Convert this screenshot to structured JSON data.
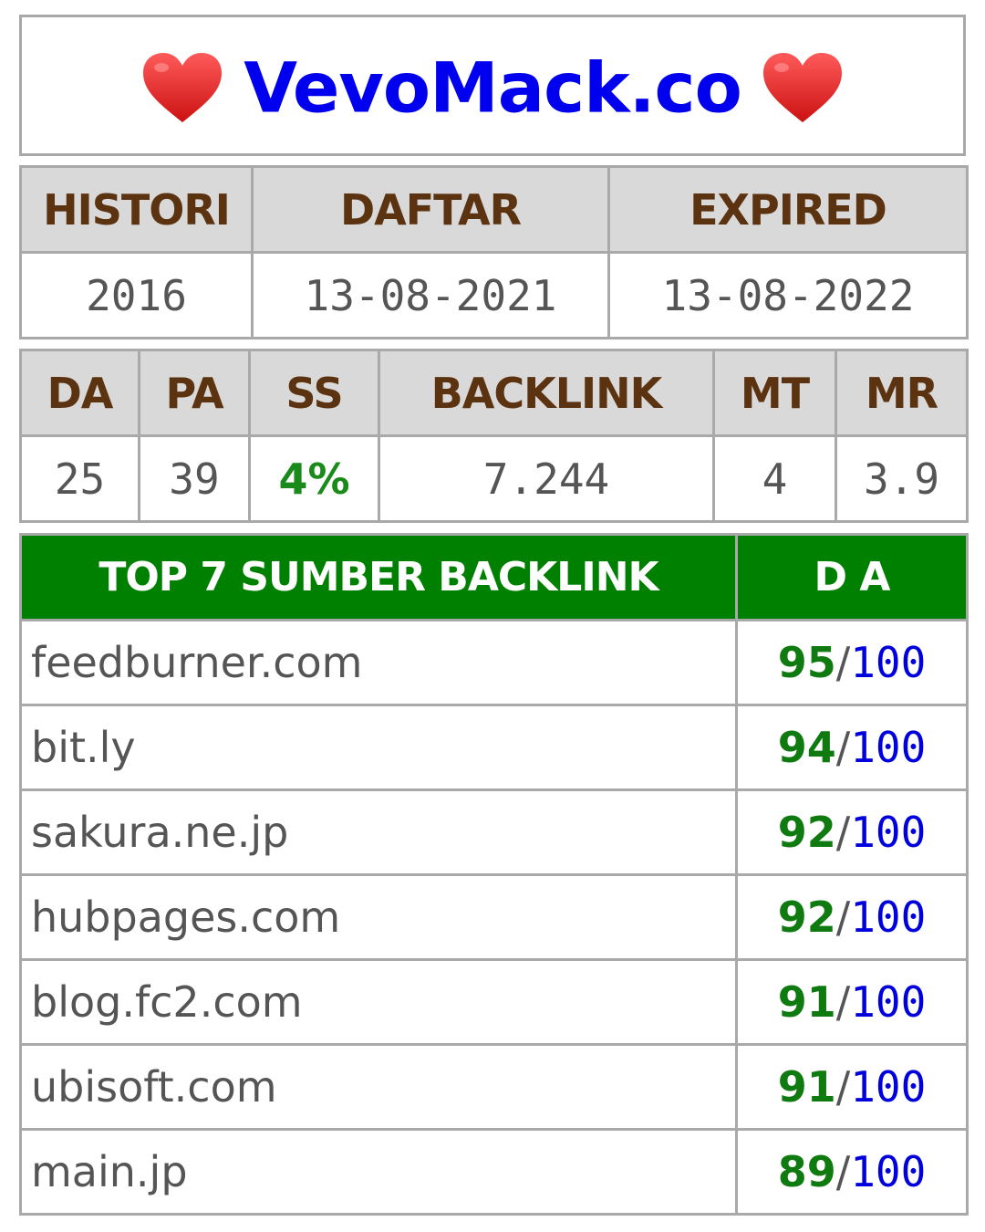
{
  "title": {
    "text": "VevoMack.co",
    "left_icon": "heart-icon",
    "right_icon": "heart-icon",
    "heart_color": "#e02424"
  },
  "history": {
    "headers": [
      "HISTORI",
      "DAFTAR",
      "EXPIRED"
    ],
    "values": [
      "2016",
      "13-08-2021",
      "13-08-2022"
    ]
  },
  "metrics": {
    "headers": [
      "DA",
      "PA",
      "SS",
      "BACKLINK",
      "MT",
      "MR"
    ],
    "values": [
      "25",
      "39",
      "4%",
      "7.244",
      "4",
      "3.9"
    ]
  },
  "top_backlinks": {
    "header_source": "TOP 7 SUMBER BACKLINK",
    "header_da": "D A",
    "separator": "/",
    "max_label": "100",
    "rows": [
      {
        "site": "feedburner.com",
        "da": "95"
      },
      {
        "site": "bit.ly",
        "da": "94"
      },
      {
        "site": "sakura.ne.jp",
        "da": "92"
      },
      {
        "site": "hubpages.com",
        "da": "92"
      },
      {
        "site": "blog.fc2.com",
        "da": "91"
      },
      {
        "site": "ubisoft.com",
        "da": "91"
      },
      {
        "site": "main.jp",
        "da": "89"
      }
    ]
  },
  "colors": {
    "title": "#0000ee",
    "header_text": "#5c3310",
    "header_bg": "#d9d9d9",
    "top_header_bg": "#008000",
    "score_green": "#0f7a0f",
    "max_blue": "#0000dd"
  }
}
